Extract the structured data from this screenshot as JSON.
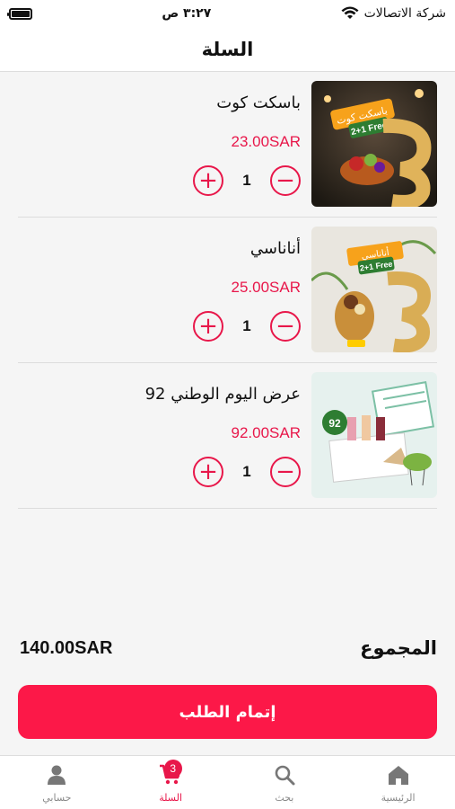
{
  "status": {
    "carrier": "شركة الاتصالات",
    "time": "٣:٢٧ ص"
  },
  "header": {
    "title": "السلة"
  },
  "cart": {
    "currency_note": "SAR",
    "items": [
      {
        "name": "باسكت كوت",
        "price": "23.00SAR",
        "qty": "1",
        "image_text": "باسكت كوت",
        "badge": "2+1 Free"
      },
      {
        "name": "أناناسي",
        "price": "25.00SAR",
        "qty": "1",
        "image_text": "أناناسي",
        "badge": "2+1 Free"
      },
      {
        "name": "عرض اليوم الوطني 92",
        "price": "92.00SAR",
        "qty": "1",
        "image_text": "92",
        "badge": ""
      }
    ]
  },
  "summary": {
    "label": "المجموع",
    "amount": "140.00SAR"
  },
  "checkout": {
    "label": "إتمام الطلب"
  },
  "tabs": [
    {
      "label": "حسابي",
      "icon": "person-icon"
    },
    {
      "label": "السلة",
      "icon": "cart-icon",
      "badge": "3"
    },
    {
      "label": "بحث",
      "icon": "search-icon"
    },
    {
      "label": "الرئيسية",
      "icon": "home-icon"
    }
  ],
  "colors": {
    "accent": "#e8174a",
    "button": "#fc1848"
  }
}
